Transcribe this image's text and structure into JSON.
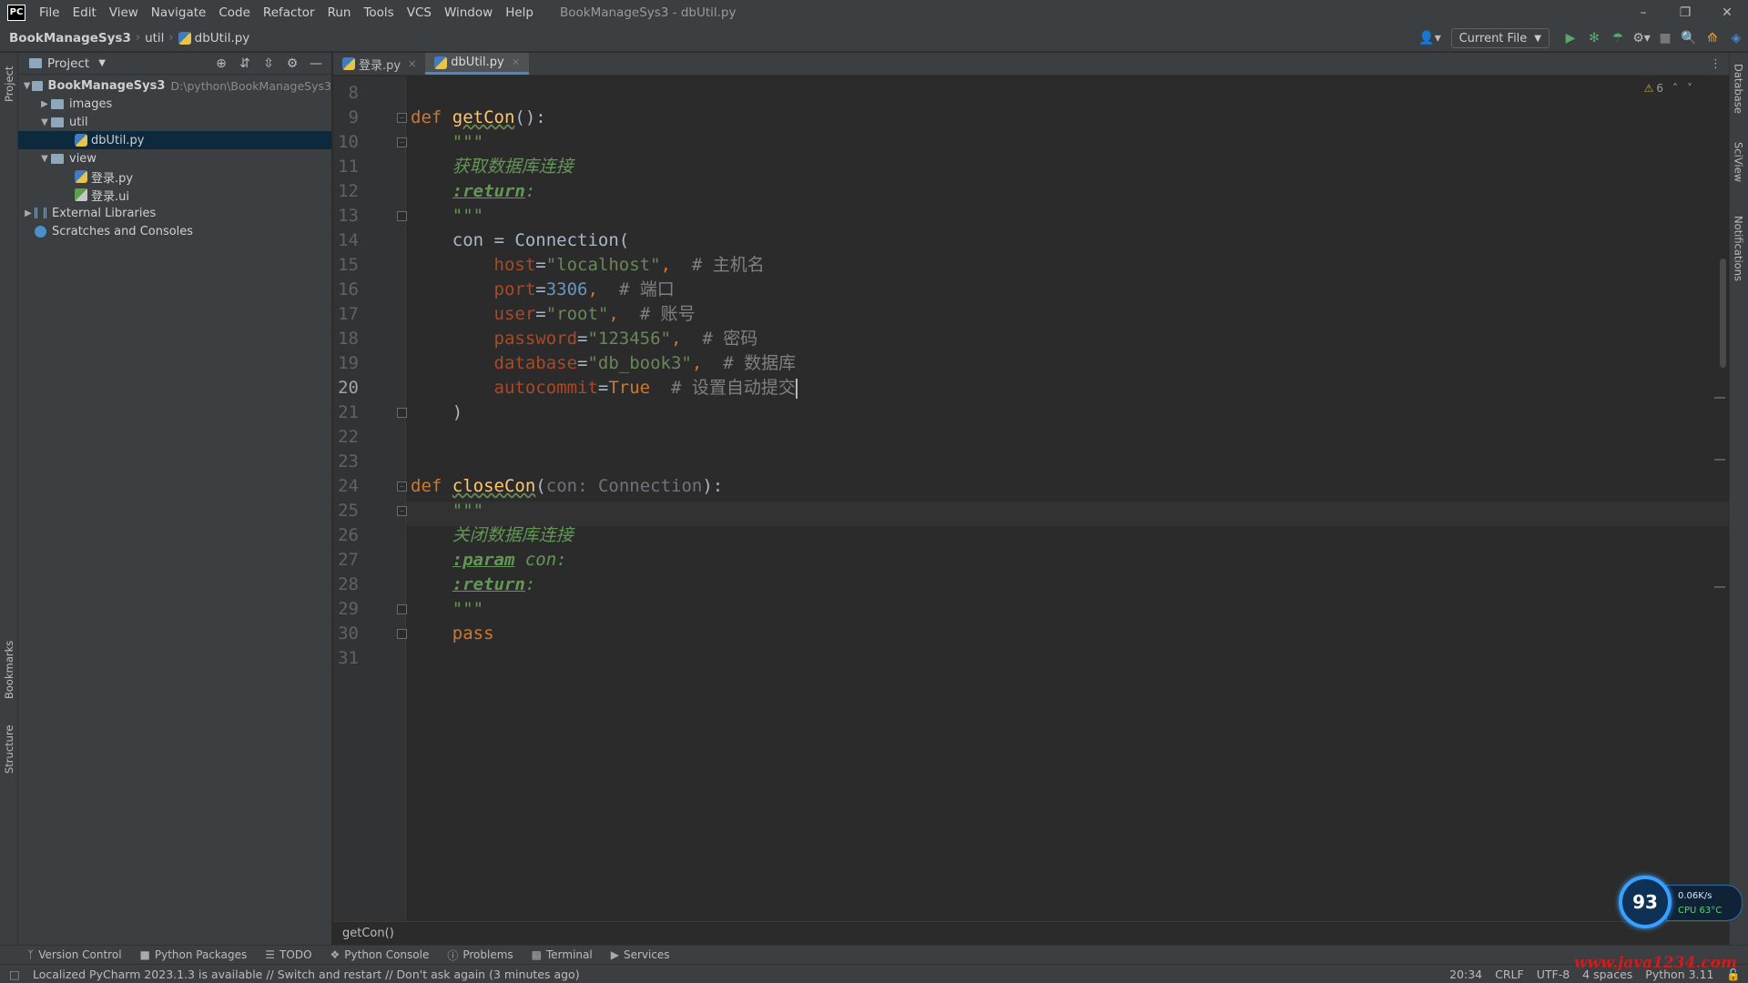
{
  "menubar": {
    "logo": "PC",
    "items": [
      "File",
      "Edit",
      "View",
      "Navigate",
      "Code",
      "Refactor",
      "Run",
      "Tools",
      "VCS",
      "Window",
      "Help"
    ],
    "window_title": "BookManageSys3 - dbUtil.py"
  },
  "navbar": {
    "breadcrumb": [
      "BookManageSys3",
      "util",
      "dbUtil.py"
    ],
    "run_config": "Current File"
  },
  "project_panel": {
    "title": "Project",
    "tree": [
      {
        "label": "BookManageSys3",
        "path": "D:\\python\\BookManageSys3",
        "type": "folder",
        "expanded": true
      },
      {
        "label": "images",
        "type": "folder",
        "expanded": false
      },
      {
        "label": "util",
        "type": "folder",
        "expanded": true
      },
      {
        "label": "dbUtil.py",
        "type": "python-file",
        "selected": true
      },
      {
        "label": "view",
        "type": "folder",
        "expanded": true
      },
      {
        "label": "登录.py",
        "type": "python-file"
      },
      {
        "label": "登录.ui",
        "type": "ui-file"
      },
      {
        "label": "External Libraries",
        "type": "library",
        "expanded": false
      },
      {
        "label": "Scratches and Consoles",
        "type": "scratch"
      }
    ]
  },
  "side_tabs": {
    "left": [
      "Project",
      "Bookmarks",
      "Structure"
    ],
    "right": [
      "Database",
      "SciView",
      "Notifications"
    ]
  },
  "editor_tabs": [
    {
      "label": "登录.py",
      "active": false
    },
    {
      "label": "dbUtil.py",
      "active": true
    }
  ],
  "editor": {
    "inspection_count": "6",
    "current_line": "20",
    "lines": [
      {
        "n": "8",
        "text": ""
      },
      {
        "n": "9",
        "text": "def getCon():"
      },
      {
        "n": "10",
        "text": "\"\"\""
      },
      {
        "n": "11",
        "text": "获取数据库连接"
      },
      {
        "n": "12",
        "text": ":return:"
      },
      {
        "n": "13",
        "text": "\"\"\""
      },
      {
        "n": "14",
        "text": "con = Connection("
      },
      {
        "n": "15",
        "text": "host=\"localhost\",  # 主机名"
      },
      {
        "n": "16",
        "text": "port=3306,  # 端口"
      },
      {
        "n": "17",
        "text": "user=\"root\",  # 账号"
      },
      {
        "n": "18",
        "text": "password=\"123456\",  # 密码"
      },
      {
        "n": "19",
        "text": "database=\"db_book3\",  # 数据库"
      },
      {
        "n": "20",
        "text": "autocommit=True  # 设置自动提交"
      },
      {
        "n": "21",
        "text": ")"
      },
      {
        "n": "22",
        "text": ""
      },
      {
        "n": "23",
        "text": ""
      },
      {
        "n": "24",
        "text": "def closeCon(con: Connection):"
      },
      {
        "n": "25",
        "text": "\"\"\""
      },
      {
        "n": "26",
        "text": "关闭数据库连接"
      },
      {
        "n": "27",
        "text": ":param con:"
      },
      {
        "n": "28",
        "text": ":return:"
      },
      {
        "n": "29",
        "text": "\"\"\""
      },
      {
        "n": "30",
        "text": "pass"
      },
      {
        "n": "31",
        "text": ""
      }
    ],
    "tokens": {
      "def": "def",
      "getCon": "getCon",
      "getCon_parens": "():",
      "docquote": "\"\"\"",
      "doc_get": "获取数据库连接",
      "return_tag": ":return",
      "colon": ":",
      "con_assign": "con = Connection(",
      "host_key": "host",
      "host_val": "\"localhost\"",
      "host_cmt": "# 主机名",
      "port_key": "port",
      "port_val": "3306",
      "port_cmt": "# 端口",
      "user_key": "user",
      "user_val": "\"root\"",
      "user_cmt": "# 账号",
      "pwd_key": "password",
      "pwd_val": "\"123456\"",
      "pwd_cmt": "# 密码",
      "db_key": "database",
      "db_val": "\"db_book3\"",
      "db_cmt": "# 数据库",
      "ac_key": "autocommit",
      "ac_val": "True",
      "ac_cmt": "# 设置自动提交",
      "close_paren": ")",
      "closeCon": "closeCon",
      "close_param": "con: Connection",
      "doc_close": "关闭数据库连接",
      "param_tag": ":param",
      "param_name": "con:",
      "pass_kw": "pass"
    }
  },
  "breadcrumb_bar": {
    "text": "getCon()"
  },
  "tool_windows": [
    "Version Control",
    "Python Packages",
    "TODO",
    "Python Console",
    "Problems",
    "Terminal",
    "Services"
  ],
  "statusbar": {
    "message": "Localized PyCharm 2023.1.3 is available // Switch and restart // Don't ask again (3 minutes ago)",
    "position": "20:34",
    "line_sep": "CRLF",
    "encoding": "UTF-8",
    "indent": "4 spaces",
    "interpreter": "Python 3.11"
  },
  "speed_widget": {
    "score": "93",
    "net": "0.06K/s",
    "cpu": "CPU 63°C"
  },
  "watermark": "www.java1234.com",
  "colors": {
    "keyword": "#cc7832",
    "function": "#ffc66d",
    "string": "#6a8759",
    "number": "#6897bb",
    "comment": "#808080",
    "param": "#aa4926",
    "selection": "#0d293e",
    "accent": "#4a88c7"
  }
}
